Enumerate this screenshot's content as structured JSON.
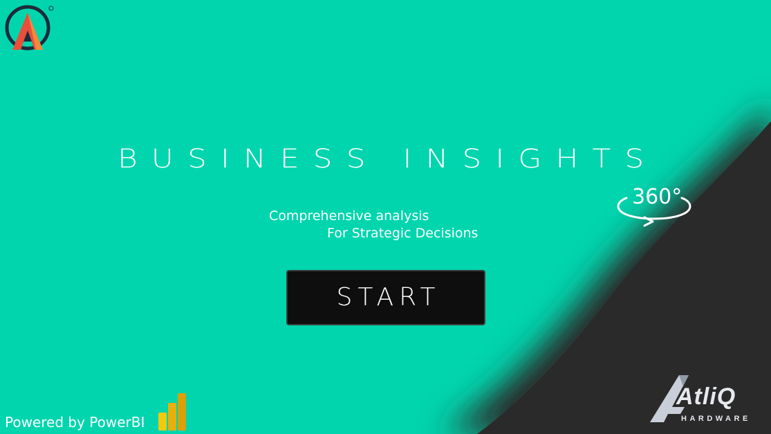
{
  "title": "BUSINESS INSIGHTS",
  "badge": {
    "text": "360°"
  },
  "subtitle": {
    "line1": "Comprehensive analysis",
    "line2": "For Strategic Decisions"
  },
  "start_button": {
    "label": "START"
  },
  "footer": {
    "powered_by": "Powered by PowerBI"
  },
  "brand": {
    "name": "AtliQ",
    "tagline": "HARDWARE"
  },
  "colors": {
    "background": "#01d5ae",
    "dark_corner": "#2b2b2b",
    "button": "#0e0e0e",
    "text": "#ffffff",
    "logo_red": "#e94f3a",
    "logo_orange": "#f28a3a",
    "powerbi_yellow": "#f2c811"
  },
  "icons": {
    "top_logo": "a-triangle-logo-icon",
    "badge": "360-rotation-icon",
    "powerbi": "powerbi-icon",
    "atliq": "atliq-hardware-logo-icon"
  }
}
